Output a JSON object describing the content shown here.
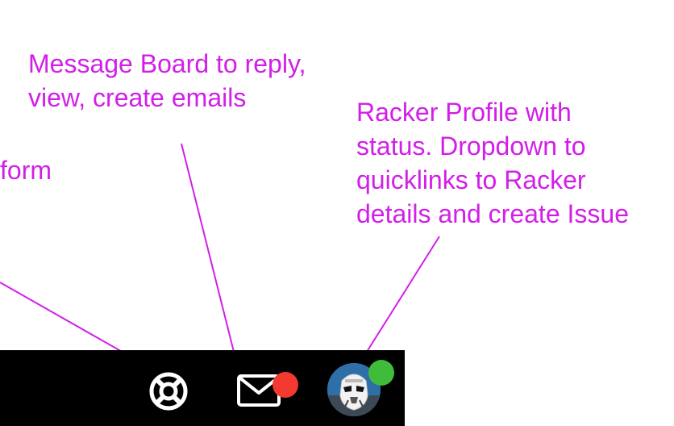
{
  "annotations": {
    "message_board": "Message Board to reply,\nview, create emails",
    "racker_profile": "Racker Profile with\nstatus. Dropdown to\nquicklinks to Racker\ndetails and create Issue",
    "form_fragment": "form"
  },
  "colors": {
    "annotation": "#d21fe8",
    "toolbar_bg": "#000000",
    "icon": "#ffffff",
    "notification_badge": "#f4392e",
    "status_online": "#3fbd3a"
  },
  "toolbar": {
    "icons": {
      "help": "lifebuoy-icon",
      "messages": "envelope-icon",
      "profile": "stormtrooper-avatar"
    }
  }
}
